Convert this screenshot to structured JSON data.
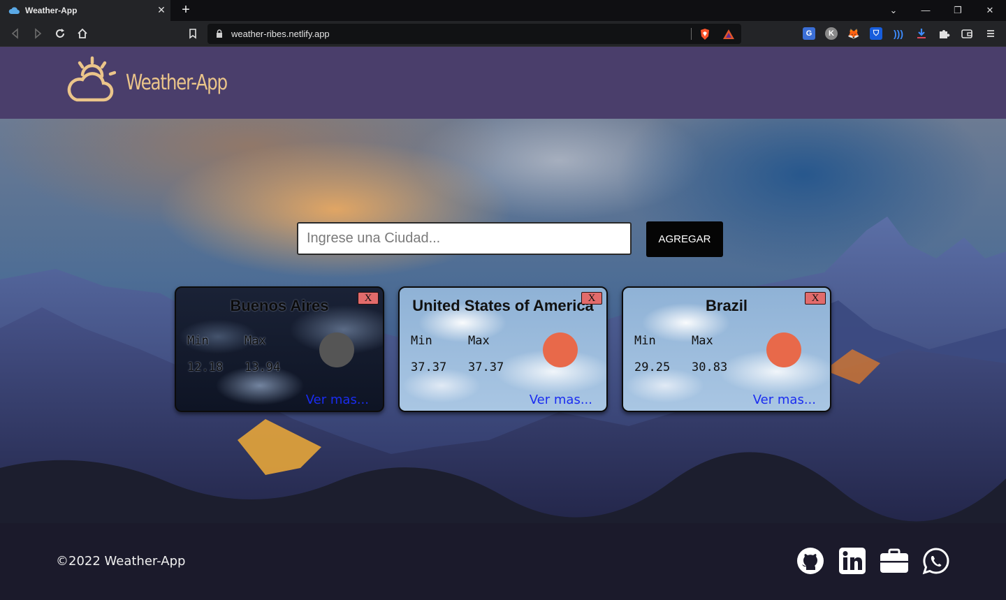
{
  "browser": {
    "tab_title": "Weather-App",
    "url": "weather-ribes.netlify.app"
  },
  "site": {
    "logo_text": "Weather-App"
  },
  "search": {
    "placeholder": "Ingrese una Ciudad...",
    "button_label": "AGREGAR"
  },
  "cards": [
    {
      "city": "Buenos Aires",
      "close_label": "X",
      "min_label": "Min",
      "max_label": "Max",
      "min": "12.18",
      "max": "13.94",
      "more_label": "Ver mas...",
      "theme": "night",
      "icon_color": "#555555"
    },
    {
      "city": "United States of America",
      "close_label": "X",
      "min_label": "Min",
      "max_label": "Max",
      "min": "37.37",
      "max": "37.37",
      "more_label": "Ver mas...",
      "theme": "day",
      "icon_color": "#e8694a"
    },
    {
      "city": "Brazil",
      "close_label": "X",
      "min_label": "Min",
      "max_label": "Max",
      "min": "29.25",
      "max": "30.83",
      "more_label": "Ver mas...",
      "theme": "day",
      "icon_color": "#e8694a"
    }
  ],
  "footer": {
    "copyright": "©2022 Weather-App",
    "social": [
      "github-icon",
      "linkedin-icon",
      "briefcase-icon",
      "whatsapp-icon"
    ]
  },
  "colors": {
    "header_bg": "#4a3e6b",
    "logo_color": "#ebc58a",
    "footer_bg": "#1b1a2b",
    "close_btn": "#e26b6b",
    "link_color": "#1a2cf0"
  }
}
